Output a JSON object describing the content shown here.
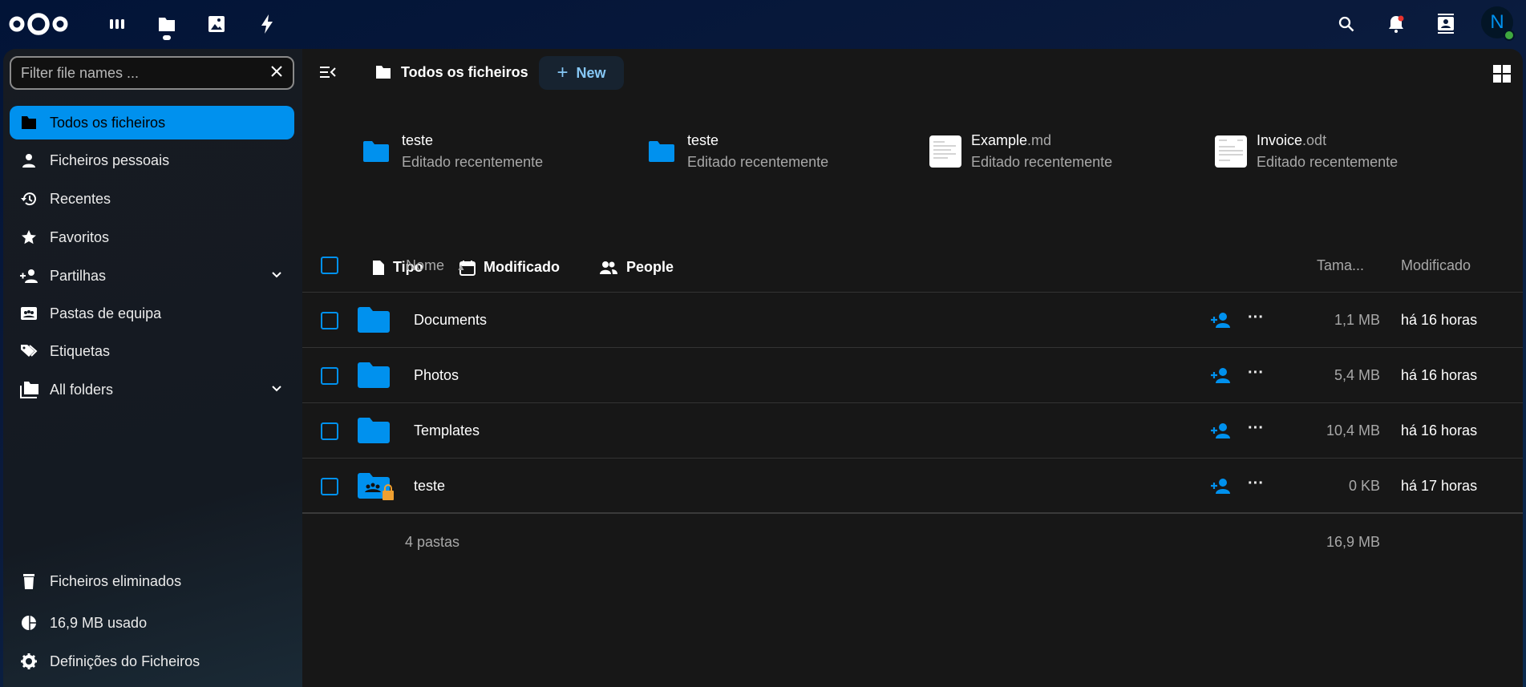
{
  "header": {
    "apps": [
      "dashboard",
      "files",
      "photos",
      "activity"
    ],
    "avatar_letter": "N",
    "colors": {
      "accent": "#0091ee",
      "status_online": "#3fa83f",
      "notification": "#e9322d"
    }
  },
  "sidebar": {
    "filter_placeholder": "Filter file names ...",
    "items": [
      {
        "label": "Todos os ficheiros",
        "icon": "folder-icon",
        "active": true
      },
      {
        "label": "Ficheiros pessoais",
        "icon": "user-icon"
      },
      {
        "label": "Recentes",
        "icon": "history-icon"
      },
      {
        "label": "Favoritos",
        "icon": "star-icon"
      },
      {
        "label": "Partilhas",
        "icon": "share-icon",
        "expandable": true
      },
      {
        "label": "Pastas de equipa",
        "icon": "team-folder-icon"
      },
      {
        "label": "Etiquetas",
        "icon": "tag-icon"
      },
      {
        "label": "All folders",
        "icon": "folders-icon",
        "expandable": true
      }
    ],
    "bottom": {
      "trash": "Ficheiros eliminados",
      "quota": "16,9 MB usado",
      "settings": "Definições do Ficheiros"
    }
  },
  "main": {
    "breadcrumb": "Todos os ficheiros",
    "new_label": "New",
    "recent": [
      {
        "name": "teste",
        "ext": "",
        "sub": "Editado recentemente",
        "type": "folder"
      },
      {
        "name": "teste",
        "ext": "",
        "sub": "Editado recentemente",
        "type": "folder"
      },
      {
        "name": "Example",
        "ext": ".md",
        "sub": "Editado recentemente",
        "type": "doc"
      },
      {
        "name": "Invoice",
        "ext": ".odt",
        "sub": "Editado recentemente",
        "type": "doc"
      }
    ],
    "filters": [
      "Tipo",
      "Modificado",
      "People"
    ],
    "columns": {
      "name": "Nome",
      "size": "Tama...",
      "modified": "Modificado"
    },
    "rows": [
      {
        "name": "Documents",
        "size": "1,1 MB",
        "modified": "há 16 horas"
      },
      {
        "name": "Photos",
        "size": "5,4 MB",
        "modified": "há 16 horas"
      },
      {
        "name": "Templates",
        "size": "10,4 MB",
        "modified": "há 16 horas"
      },
      {
        "name": "teste",
        "size": "0 KB",
        "modified": "há 17 horas"
      }
    ],
    "footer": {
      "count": "4 pastas",
      "total": "16,9 MB"
    }
  }
}
